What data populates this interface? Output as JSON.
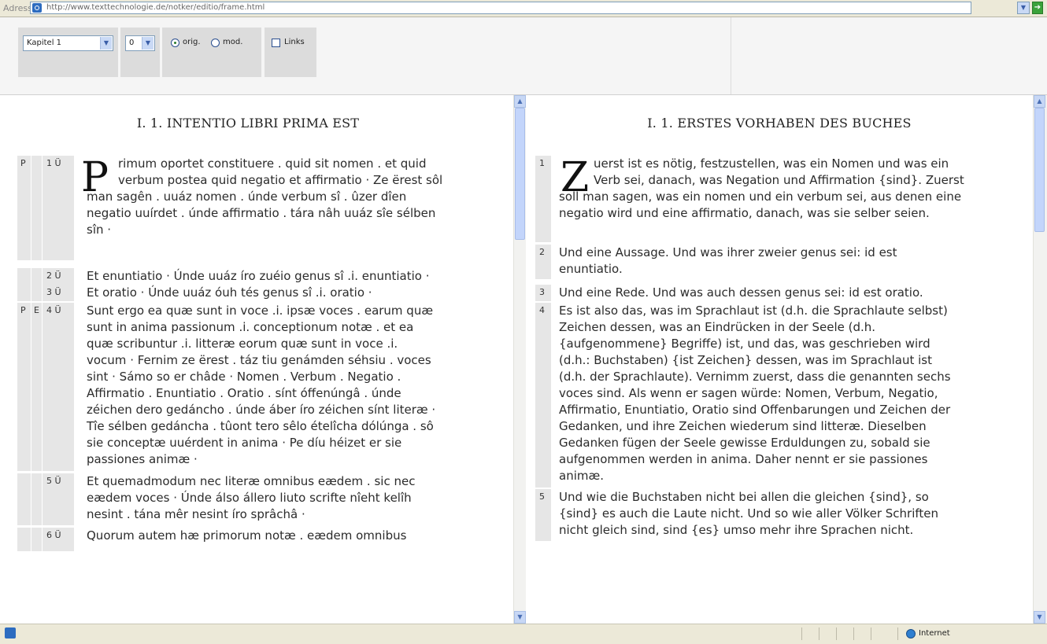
{
  "browser": {
    "address_label": "Adresse",
    "url": "http://www.texttechnologie.de/notker/editio/frame.html",
    "go_label": "Wechseln zu",
    "status_zone": "Internet"
  },
  "toolbar": {
    "chapter_select": "Kapitel 1",
    "number_select": "0",
    "radio_orig": "orig.",
    "radio_mod": "mod.",
    "checkbox_links": "Links",
    "selected_mode": "orig."
  },
  "left": {
    "heading": "I. 1. INTENTIO LIBRI PRIMA EST",
    "rows": [
      {
        "m1": "P",
        "m2": "",
        "num": "1 Ü",
        "dropcap": "P",
        "lines": [
          "rimum oportet constituere . quid sit nomen . et quid",
          "verbum postea quid negatio et affirmatio · Ze ërest sôl",
          "man sagên . uuáz nomen . únde verbum sî . ûzer dîen",
          "negatio uuírdet . únde affirmatio . tára nâh uuáz sîe sélben",
          "sîn ·"
        ]
      },
      {
        "m1": "",
        "m2": "",
        "num": "2 Ü",
        "lines": [
          "Et enuntiatio · Únde uuáz íro zuéio genus sî .i. enuntiatio ·"
        ]
      },
      {
        "m1": "",
        "m2": "",
        "num": "3 Ü",
        "lines": [
          "Et oratio · Únde uuáz óuh tés genus sî .i. oratio ·"
        ]
      },
      {
        "m1": "P",
        "m2": "E",
        "num": "4 Ü",
        "lines": [
          "Sunt ergo ea quæ sunt in voce  .i. ipsæ voces . earum quæ",
          "sunt in anima passionum  .i. conceptionum notæ . et ea",
          "quæ scribuntur  .i.  litteræ eorum quæ sunt in voce  .i.",
          "vocum  · Fernim ze ërest . táz tiu genámden séhsiu .  voces",
          "sint ·  Sámo so er châde ·  Nomen . Verbum . Negatio .",
          "Affirmatio . Enuntiatio . Oratio . sínt óffenúngâ . únde",
          "zéichen dero gedáncho . únde áber íro zéichen sínt literæ ·",
          "Tîe sélben gedáncha . tûont tero sêlo ételîcha dólúnga .  sô",
          "sie conceptæ uuérdent in anima · Pe díu héizet er sie",
          "passiones animæ ·"
        ]
      },
      {
        "m1": "",
        "m2": "",
        "num": "5 Ü",
        "lines": [
          "Et quemadmodum nec literæ omnibus eædem . sic nec",
          "eædem voces · Únde álso állero liuto scrifte nîeht kelîh",
          "nesint . tána mêr nesint íro sprâchâ ·"
        ]
      },
      {
        "m1": "",
        "m2": "",
        "num": "6 Ü",
        "lines": [
          "Quorum autem hæ primorum notæ . eædem omnibus"
        ]
      }
    ]
  },
  "right": {
    "heading": "I. 1. ERSTES VORHABEN DES BUCHES",
    "rows": [
      {
        "num": "1",
        "dropcap": "Z",
        "lines": [
          "uerst ist es nötig, festzustellen, was ein Nomen und was ein",
          "Verb sei, danach, was Negation und Affirmation {sind}. Zuerst",
          "soll man sagen, was ein nomen und ein verbum sei, aus denen eine",
          "negatio wird und eine affirmatio, danach, was sie selber seien."
        ]
      },
      {
        "num": "2",
        "lines": [
          "Und eine Aussage. Und was ihrer zweier genus sei: id est",
          "enuntiatio."
        ]
      },
      {
        "num": "3",
        "lines": [
          "Und eine Rede. Und was auch dessen genus sei: id est oratio."
        ]
      },
      {
        "num": "4",
        "lines": [
          "Es ist also das, was im Sprachlaut ist (d.h. die Sprachlaute selbst)",
          "Zeichen dessen, was an Eindrücken in der Seele (d.h.",
          "{aufgenommene} Begriffe) ist, und das, was geschrieben wird",
          "(d.h.: Buchstaben) {ist Zeichen} dessen, was im Sprachlaut ist",
          "(d.h. der Sprachlaute). Vernimm zuerst, dass die genannten sechs",
          "voces sind. Als wenn er sagen würde: Nomen, Verbum, Negatio,",
          "Affirmatio, Enuntiatio, Oratio sind Offenbarungen und Zeichen der",
          "Gedanken, und ihre Zeichen wiederum sind litteræ. Dieselben",
          "Gedanken fügen der Seele gewisse Erduldungen zu, sobald sie",
          "aufgenommen werden in anima. Daher nennt er sie passiones",
          "animæ."
        ]
      },
      {
        "num": "5",
        "lines": [
          "Und wie die Buchstaben nicht bei allen die gleichen {sind}, so",
          "{sind} es auch die Laute nicht. Und so wie aller Völker Schriften",
          "nicht gleich sind, sind {es} umso mehr ihre Sprachen nicht."
        ]
      }
    ]
  }
}
